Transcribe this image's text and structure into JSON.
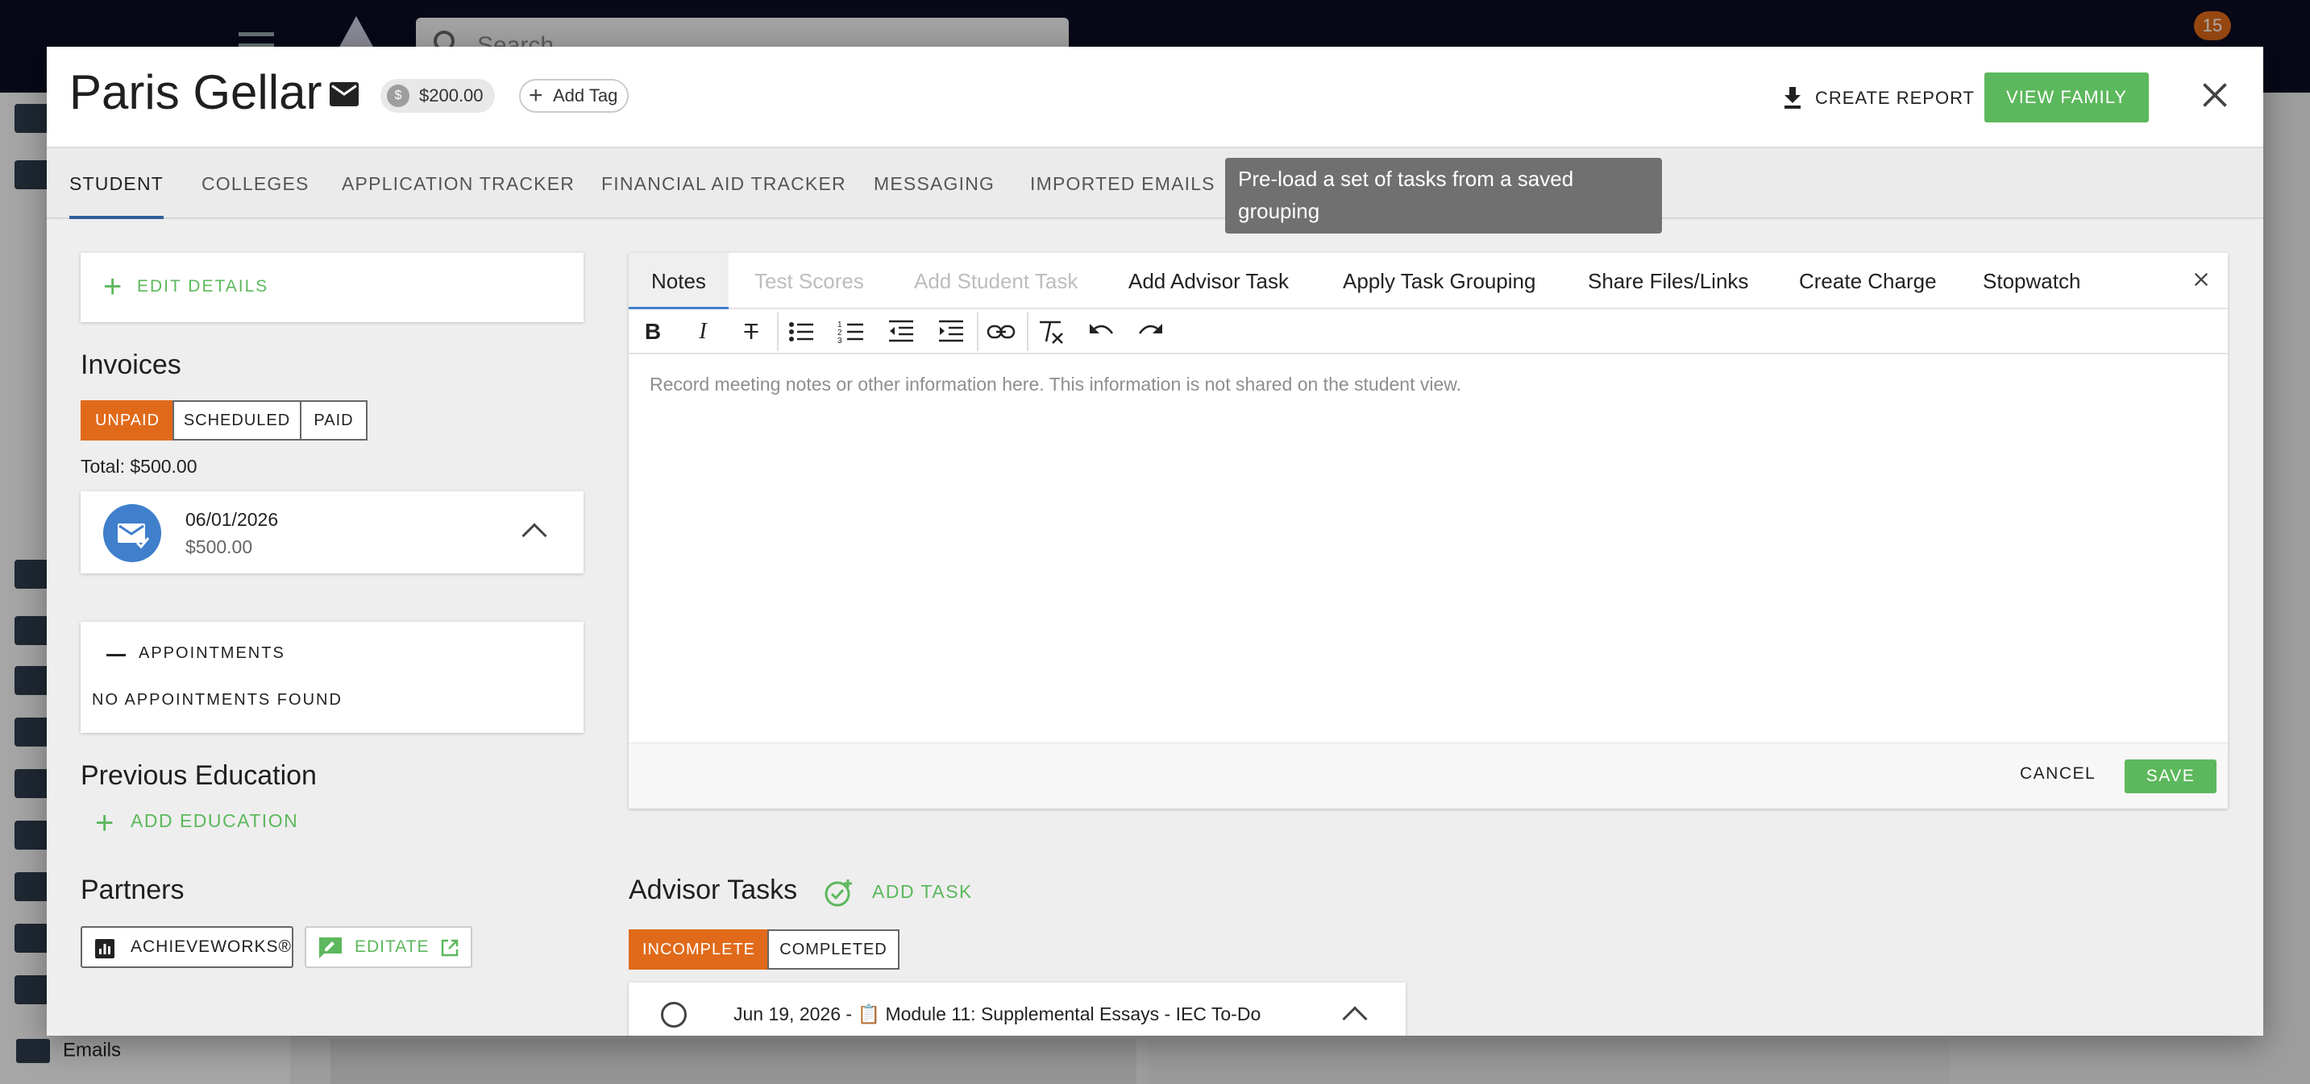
{
  "background": {
    "search_placeholder": "Search",
    "notification_count": "15",
    "sidebar_visible_item": "Emails"
  },
  "modal": {
    "student_name": "Paris Gellar",
    "balance": "$200.00",
    "balance_currency_symbol": "$",
    "add_tag_label": "Add Tag",
    "create_report_label": "CREATE REPORT",
    "view_family_label": "VIEW FAMILY",
    "tabs": [
      {
        "label": "STUDENT",
        "active": true
      },
      {
        "label": "COLLEGES"
      },
      {
        "label": "APPLICATION TRACKER"
      },
      {
        "label": "FINANCIAL AID TRACKER"
      },
      {
        "label": "MESSAGING"
      },
      {
        "label": "IMPORTED EMAILS"
      }
    ],
    "tooltip": "Pre-load a set of tasks from a saved grouping"
  },
  "left": {
    "edit_details_label": "EDIT DETAILS",
    "invoices": {
      "title": "Invoices",
      "filters": [
        "UNPAID",
        "SCHEDULED",
        "PAID"
      ],
      "active_filter": "UNPAID",
      "total_label": "Total: $500.00",
      "items": [
        {
          "date": "06/01/2026",
          "amount": "$500.00"
        }
      ]
    },
    "appointments": {
      "label": "APPOINTMENTS",
      "empty_text": "NO APPOINTMENTS FOUND"
    },
    "previous_education": {
      "title": "Previous Education",
      "add_label": "ADD EDUCATION"
    },
    "partners": {
      "title": "Partners",
      "items": [
        "ACHIEVEWORKS®",
        "EDITATE"
      ]
    }
  },
  "editor": {
    "tabs": [
      {
        "label": "Notes",
        "state": "active"
      },
      {
        "label": "Test Scores",
        "state": "disabled"
      },
      {
        "label": "Add Student Task",
        "state": "disabled"
      },
      {
        "label": "Add Advisor Task",
        "state": "enabled"
      },
      {
        "label": "Apply Task Grouping",
        "state": "enabled"
      },
      {
        "label": "Share Files/Links",
        "state": "enabled"
      },
      {
        "label": "Create Charge",
        "state": "enabled"
      },
      {
        "label": "Stopwatch",
        "state": "enabled"
      }
    ],
    "toolbar_icons": [
      "bold-icon",
      "italic-icon",
      "strikethrough-icon",
      "bullet-list-icon",
      "numbered-list-icon",
      "outdent-icon",
      "indent-icon",
      "link-icon",
      "clear-format-icon",
      "undo-icon",
      "redo-icon"
    ],
    "placeholder": "Record meeting notes or other information here. This information is not shared on the student view.",
    "cancel_label": "CANCEL",
    "save_label": "SAVE"
  },
  "advisor_tasks": {
    "title": "Advisor Tasks",
    "add_label": "ADD TASK",
    "filters": [
      "INCOMPLETE",
      "COMPLETED"
    ],
    "active_filter": "INCOMPLETE",
    "items": [
      {
        "text": "Jun 19, 2026 - 📋 Module 11: Supplemental Essays - IEC To-Do"
      }
    ]
  },
  "colors": {
    "accent_green": "#5cb85c",
    "accent_orange": "#e06a1a",
    "accent_blue": "#3f7fcc",
    "topbar": "#0b0c24"
  }
}
